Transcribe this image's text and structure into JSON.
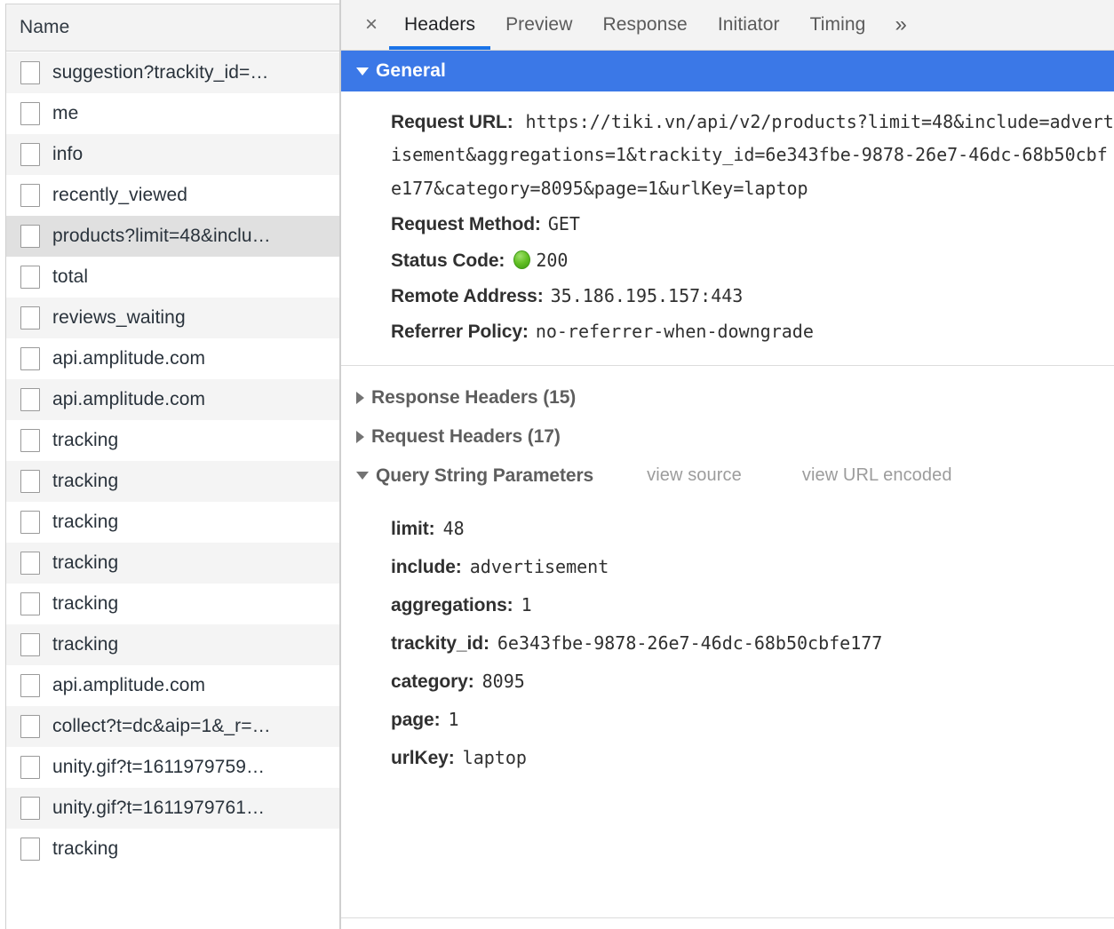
{
  "left_panel": {
    "column_header": "Name",
    "requests": [
      {
        "name": "suggestion?trackity_id=…",
        "selected": false
      },
      {
        "name": "me",
        "selected": false
      },
      {
        "name": "info",
        "selected": false
      },
      {
        "name": "recently_viewed",
        "selected": false
      },
      {
        "name": "products?limit=48&inclu…",
        "selected": true
      },
      {
        "name": "total",
        "selected": false
      },
      {
        "name": "reviews_waiting",
        "selected": false
      },
      {
        "name": "api.amplitude.com",
        "selected": false
      },
      {
        "name": "api.amplitude.com",
        "selected": false
      },
      {
        "name": "tracking",
        "selected": false
      },
      {
        "name": "tracking",
        "selected": false
      },
      {
        "name": "tracking",
        "selected": false
      },
      {
        "name": "tracking",
        "selected": false
      },
      {
        "name": "tracking",
        "selected": false
      },
      {
        "name": "tracking",
        "selected": false
      },
      {
        "name": "api.amplitude.com",
        "selected": false
      },
      {
        "name": "collect?t=dc&aip=1&_r=…",
        "selected": false
      },
      {
        "name": "unity.gif?t=1611979759…",
        "selected": false
      },
      {
        "name": "unity.gif?t=1611979761…",
        "selected": false
      },
      {
        "name": "tracking",
        "selected": false
      }
    ]
  },
  "tabbar": {
    "close_label": "×",
    "more_label": "»",
    "tabs": [
      {
        "label": "Headers",
        "active": true
      },
      {
        "label": "Preview",
        "active": false
      },
      {
        "label": "Response",
        "active": false
      },
      {
        "label": "Initiator",
        "active": false
      },
      {
        "label": "Timing",
        "active": false
      }
    ]
  },
  "general": {
    "section_label": "General",
    "request_url_key": "Request URL:",
    "request_url_value": "https://tiki.vn/api/v2/products?limit=48&include=advertisement&aggregations=1&trackity_id=6e343fbe-9878-26e7-46dc-68b50cbfe177&category=8095&page=1&urlKey=laptop",
    "request_method_key": "Request Method:",
    "request_method_value": "GET",
    "status_code_key": "Status Code:",
    "status_code_value": "200",
    "remote_address_key": "Remote Address:",
    "remote_address_value": "35.186.195.157:443",
    "referrer_policy_key": "Referrer Policy:",
    "referrer_policy_value": "no-referrer-when-downgrade"
  },
  "sections": {
    "response_headers_label": "Response Headers (15)",
    "request_headers_label": "Request Headers (17)",
    "query_string_label": "Query String Parameters",
    "view_source_label": "view source",
    "view_url_encoded_label": "view URL encoded"
  },
  "query_string_parameters": [
    {
      "key": "limit:",
      "value": "48"
    },
    {
      "key": "include:",
      "value": "advertisement"
    },
    {
      "key": "aggregations:",
      "value": "1"
    },
    {
      "key": "trackity_id:",
      "value": "6e343fbe-9878-26e7-46dc-68b50cbfe177"
    },
    {
      "key": "category:",
      "value": "8095"
    },
    {
      "key": "page:",
      "value": "1"
    },
    {
      "key": "urlKey:",
      "value": "laptop"
    }
  ],
  "colors": {
    "accent_blue": "#3b78e7",
    "tab_underline": "#1a73e8",
    "status_green": "#5fb91c",
    "row_zebra": "#f4f4f4",
    "row_selected": "#e0e0e0"
  }
}
